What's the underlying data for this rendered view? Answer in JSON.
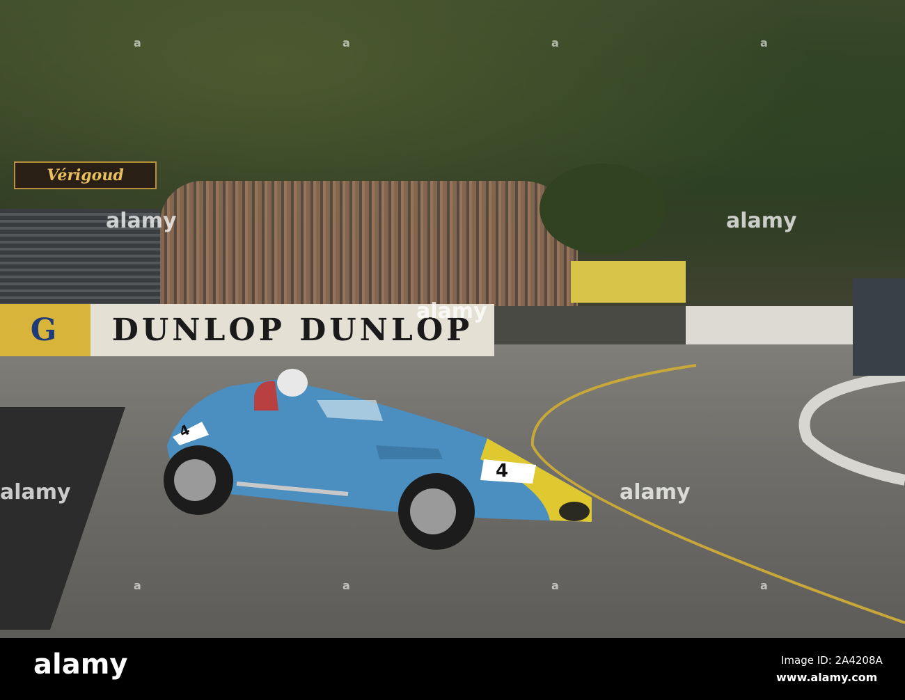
{
  "photo": {
    "sign_text": "Vérigoud",
    "banner_left": "G",
    "banner_main": "DUNLOP DUNLOP",
    "car_number": "4",
    "colors": {
      "car": "#4a8fc0",
      "nose": "#e0c830",
      "road": "#767470"
    }
  },
  "watermark": {
    "text": "alamy",
    "small": "a"
  },
  "footer": {
    "logo": "alamy",
    "image_id": "Image ID: 2A4208A",
    "url": "www.alamy.com"
  }
}
